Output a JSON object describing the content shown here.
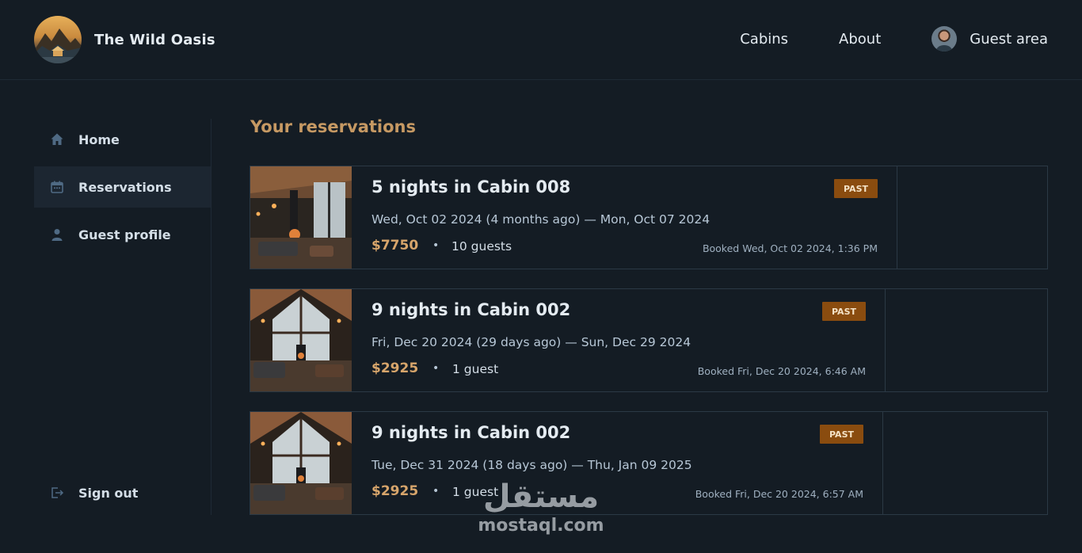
{
  "header": {
    "brand": "The Wild Oasis",
    "nav": {
      "cabins": "Cabins",
      "about": "About",
      "guest_area": "Guest area"
    }
  },
  "sidebar": {
    "items": [
      {
        "label": "Home",
        "icon": "home-icon"
      },
      {
        "label": "Reservations",
        "icon": "calendar-icon",
        "active": true
      },
      {
        "label": "Guest profile",
        "icon": "user-icon"
      }
    ],
    "sign_out": {
      "label": "Sign out",
      "icon": "sign-out-icon"
    }
  },
  "main": {
    "title": "Your reservations",
    "reservations": [
      {
        "title": "5 nights in Cabin 008",
        "status": "PAST",
        "dates": "Wed, Oct 02 2024 (4 months ago) — Mon, Oct 07 2024",
        "price": "$7750",
        "guests": "10 guests",
        "booked": "Booked Wed, Oct 02 2024, 1:36 PM"
      },
      {
        "title": "9 nights in Cabin 002",
        "status": "PAST",
        "dates": "Fri, Dec 20 2024 (29 days ago) — Sun, Dec 29 2024",
        "price": "$2925",
        "guests": "1 guest",
        "booked": "Booked Fri, Dec 20 2024, 6:46 AM"
      },
      {
        "title": "9 nights in Cabin 002",
        "status": "PAST",
        "dates": "Tue, Dec 31 2024 (18 days ago) — Thu, Jan 09 2025",
        "price": "$2925",
        "guests": "1 guest",
        "booked": "Booked Fri, Dec 20 2024, 6:57 AM"
      }
    ]
  },
  "watermark": {
    "arabic": "مستقل",
    "latin": "mostaql.com"
  },
  "colors": {
    "background": "#141c24",
    "accent": "#c69963",
    "badge": "#8a4c0f",
    "border": "#2b3945"
  }
}
